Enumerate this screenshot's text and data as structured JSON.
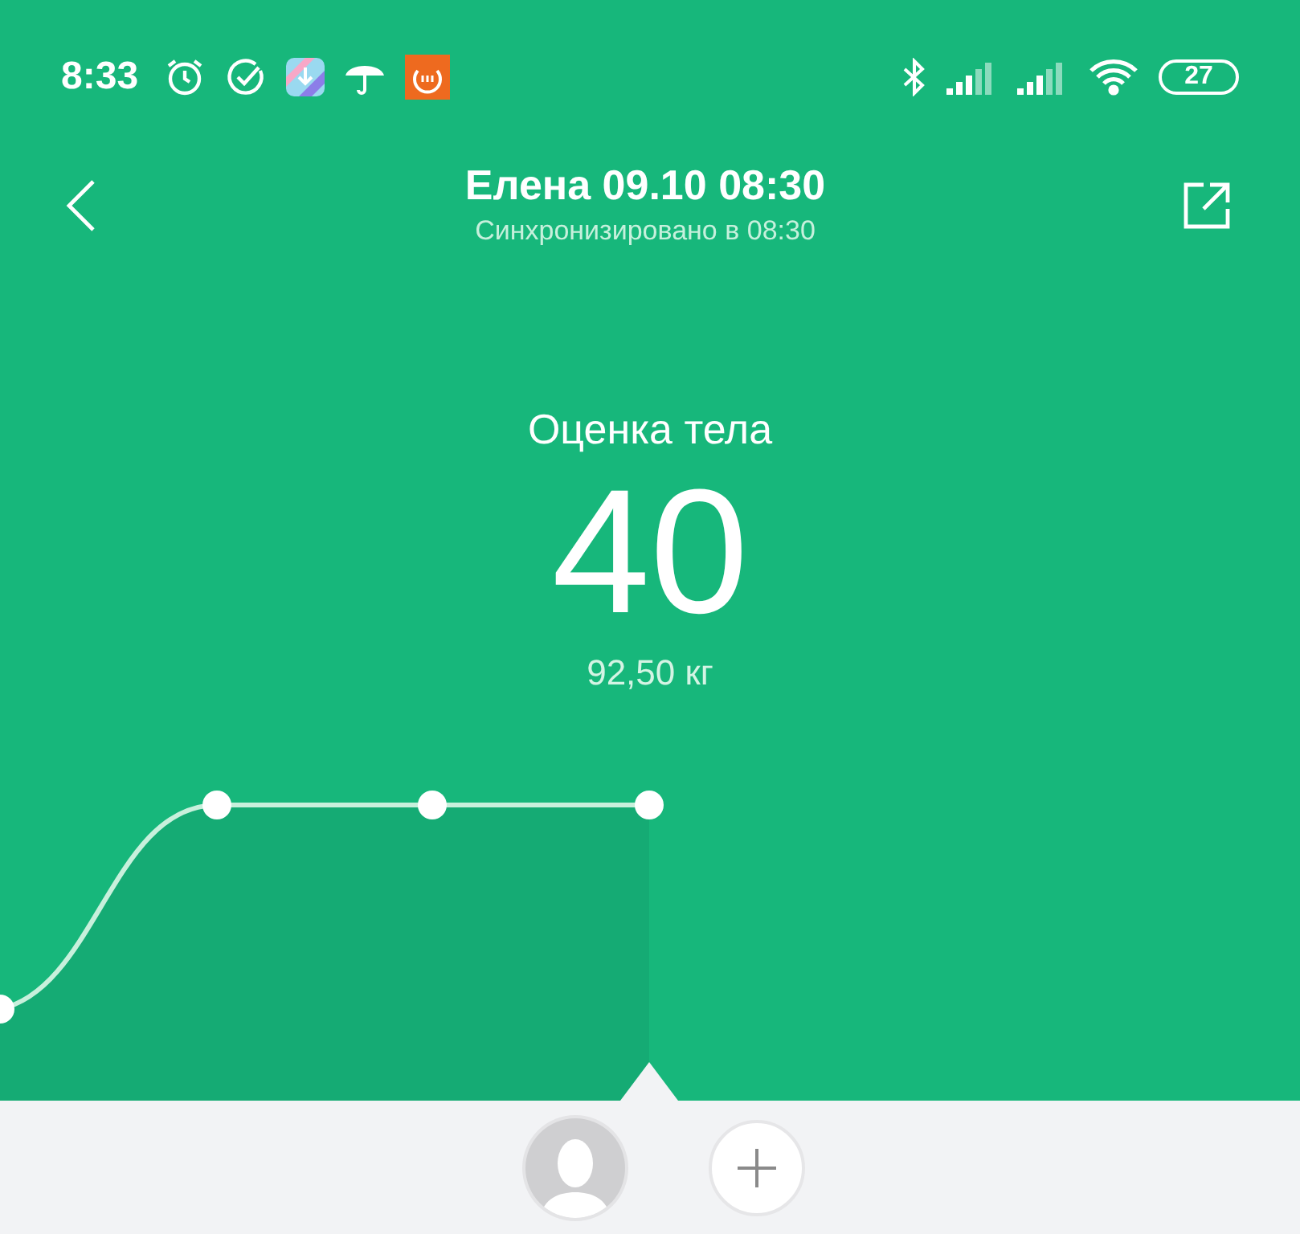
{
  "status_bar": {
    "time": "8:33",
    "battery": "27"
  },
  "header": {
    "title": "Елена 09.10 08:30",
    "subtitle": "Синхронизировано в 08:30"
  },
  "score": {
    "label": "Оценка тела",
    "value": "40",
    "weight": "92,50 кг"
  },
  "bottom_bar": {
    "profiles": [
      {
        "kind": "avatar",
        "selected": true
      },
      {
        "kind": "add",
        "selected": false
      }
    ]
  }
}
